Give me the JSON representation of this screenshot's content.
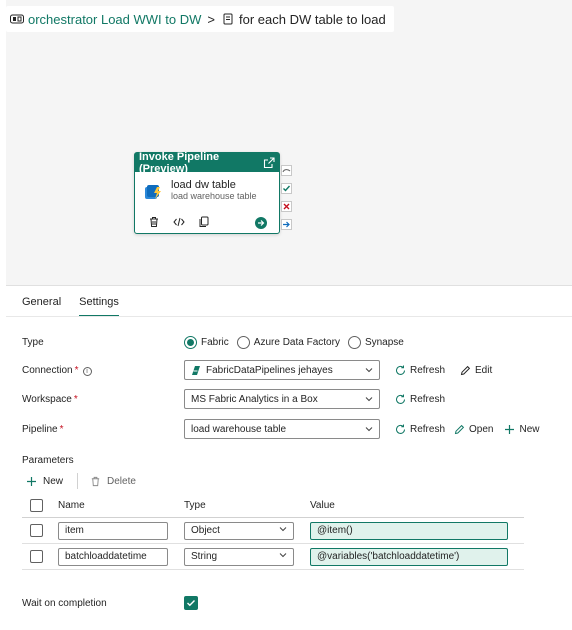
{
  "breadcrumb": {
    "pipeline": "orchestrator Load WWI to DW",
    "separator": ">",
    "activity": "for each DW table to load"
  },
  "activity": {
    "header": "Invoke Pipeline (Preview)",
    "title": "load dw table",
    "subtitle": "load warehouse table"
  },
  "tabs": [
    {
      "label": "General"
    },
    {
      "label": "Settings"
    }
  ],
  "form": {
    "type": {
      "label": "Type",
      "options": [
        "Fabric",
        "Azure Data Factory",
        "Synapse"
      ],
      "selected": "Fabric"
    },
    "connection": {
      "label": "Connection",
      "value": "FabricDataPipelines jehayes",
      "refresh": "Refresh",
      "edit": "Edit"
    },
    "workspace": {
      "label": "Workspace",
      "value": "MS Fabric Analytics in a Box",
      "refresh": "Refresh"
    },
    "pipeline": {
      "label": "Pipeline",
      "value": "load warehouse table",
      "refresh": "Refresh",
      "open": "Open",
      "new": "New"
    },
    "required_mark": "*"
  },
  "parameters": {
    "title": "Parameters",
    "new_label": "New",
    "delete_label": "Delete",
    "columns": [
      "Name",
      "Type",
      "Value"
    ],
    "rows": [
      {
        "name": "item",
        "type": "Object",
        "value": "@item()"
      },
      {
        "name": "batchloaddatetime",
        "type": "String",
        "value": "@variables('batchloaddatetime')"
      }
    ]
  },
  "wait": {
    "label": "Wait on completion",
    "checked": true
  },
  "colors": {
    "accent": "#117865",
    "required": "#c50f1f"
  }
}
